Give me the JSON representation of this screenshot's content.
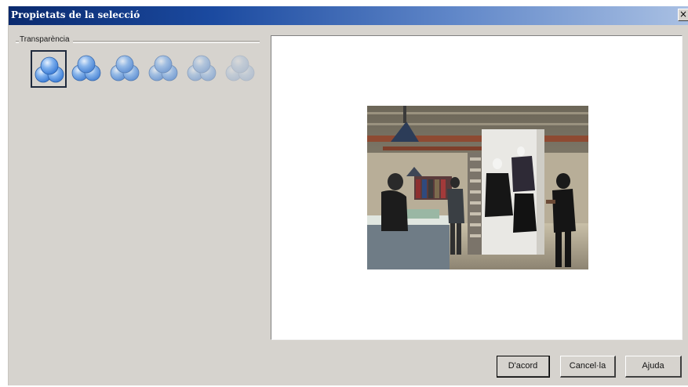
{
  "dialog": {
    "title": "Propietats de la selecció",
    "close_glyph": "×",
    "close_icon": "close-icon"
  },
  "transparency": {
    "label": "Transparència",
    "options": [
      {
        "icon": "opacity-level-icon",
        "opacity": 1.0,
        "selected": true
      },
      {
        "icon": "opacity-level-icon",
        "opacity": 0.9,
        "selected": false
      },
      {
        "icon": "opacity-level-icon",
        "opacity": 0.75,
        "selected": false
      },
      {
        "icon": "opacity-level-icon",
        "opacity": 0.6,
        "selected": false
      },
      {
        "icon": "opacity-level-icon",
        "opacity": 0.42,
        "selected": false
      },
      {
        "icon": "opacity-level-icon",
        "opacity": 0.22,
        "selected": false
      }
    ]
  },
  "preview": {
    "image": "clothing-store-photo"
  },
  "buttons": {
    "ok_label": "D'acord",
    "cancel_label": "Cancel·la",
    "help_label": "Ajuda"
  },
  "colors": {
    "title_bar_start": "#0a2a6e",
    "title_bar_end": "#a9c0e3",
    "dialog_face": "#d6d3ce",
    "icon_blue": "#3a7bd5"
  }
}
